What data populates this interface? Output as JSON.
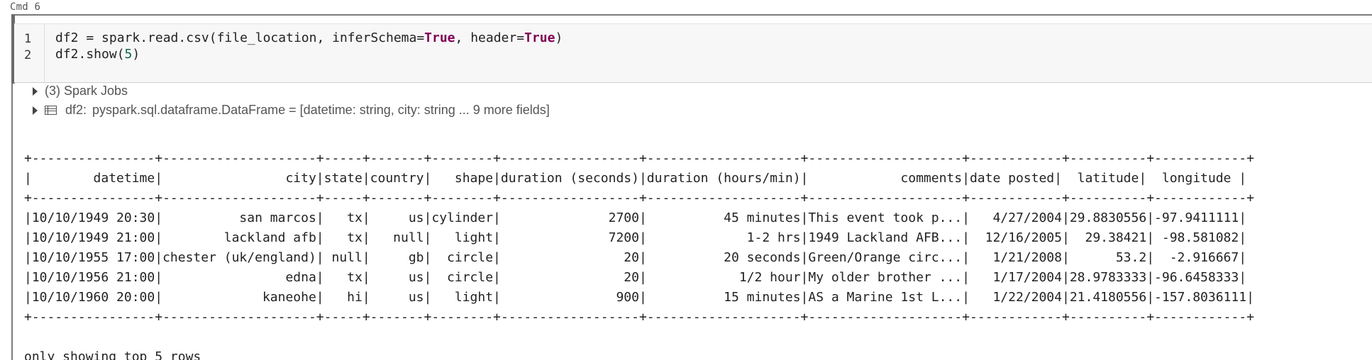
{
  "cell": {
    "label": "Cmd 6"
  },
  "code": {
    "line_numbers": [
      "1",
      "2"
    ],
    "line1": {
      "prefix": "df2 = spark.read.csv(file_location, inferSchema=",
      "kw1": "True",
      "middle": ", header=",
      "kw2": "True",
      "suffix": ")"
    },
    "line2": {
      "prefix": "df2.show(",
      "num": "5",
      "suffix": ")"
    }
  },
  "output": {
    "spark_jobs": "(3) Spark Jobs",
    "dataframe": {
      "name": "df2:",
      "schema": "pyspark.sql.dataframe.DataFrame = [datetime: string, city: string ... 9 more fields]"
    },
    "table_text": "+----------------+--------------------+-----+-------+--------+------------------+--------------------+--------------------+------------+----------+------------+\n|        datetime|                city|state|country|   shape|duration (seconds)|duration (hours/min)|            comments|date posted|  latitude|  longitude |\n+----------------+--------------------+-----+-------+--------+------------------+--------------------+--------------------+------------+----------+------------+\n|10/10/1949 20:30|          san marcos|   tx|     us|cylinder|              2700|          45 minutes|This event took p...|   4/27/2004|29.8830556|-97.9411111|\n|10/10/1949 21:00|        lackland afb|   tx|   null|   light|              7200|             1-2 hrs|1949 Lackland AFB...|  12/16/2005|  29.38421| -98.581082|\n|10/10/1955 17:00|chester (uk/england)| null|     gb|  circle|                20|          20 seconds|Green/Orange circ...|   1/21/2008|      53.2|  -2.916667|\n|10/10/1956 21:00|                edna|   tx|     us|  circle|                20|            1/2 hour|My older brother ...|   1/17/2004|28.9783333|-96.6458333|\n|10/10/1960 20:00|             kaneohe|   hi|     us|   light|               900|          15 minutes|AS a Marine 1st L...|   1/22/2004|21.4180556|-157.8036111|\n+----------------+--------------------+-----+-------+--------+------------------+--------------------+--------------------+------------+----------+------------+\n\nonly showing top 5 rows"
  },
  "icons": {
    "expand_spark_jobs": "chevron-right-icon",
    "expand_dataframe": "chevron-right-icon",
    "dataframe_table": "table-icon"
  }
}
